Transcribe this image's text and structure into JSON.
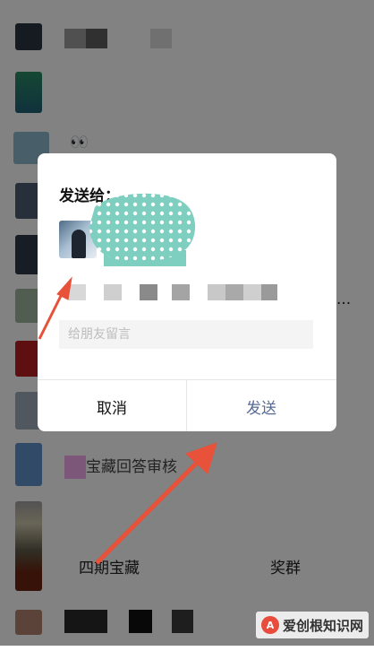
{
  "background_list": {
    "rows": [
      {
        "text": ""
      },
      {
        "text": ""
      },
      {
        "text": "👀"
      },
      {
        "text": ""
      },
      {
        "text": ""
      },
      {
        "text": "..."
      },
      {
        "text": ""
      },
      {
        "text": ""
      },
      {
        "text": "宝藏回答审核"
      },
      {
        "text": "四期宝藏"
      },
      {
        "text": "奖群"
      }
    ]
  },
  "dialog": {
    "title": "发送给：",
    "message_placeholder": "给朋友留言",
    "message_value": "",
    "cancel_label": "取消",
    "send_label": "发送"
  },
  "colors": {
    "overlay": "#000000",
    "send_accent": "#576b95",
    "arrow": "#e8513a",
    "name_blur": "#7ecfc0"
  },
  "watermark": {
    "logo": "A",
    "text": "爱创根知识网"
  }
}
